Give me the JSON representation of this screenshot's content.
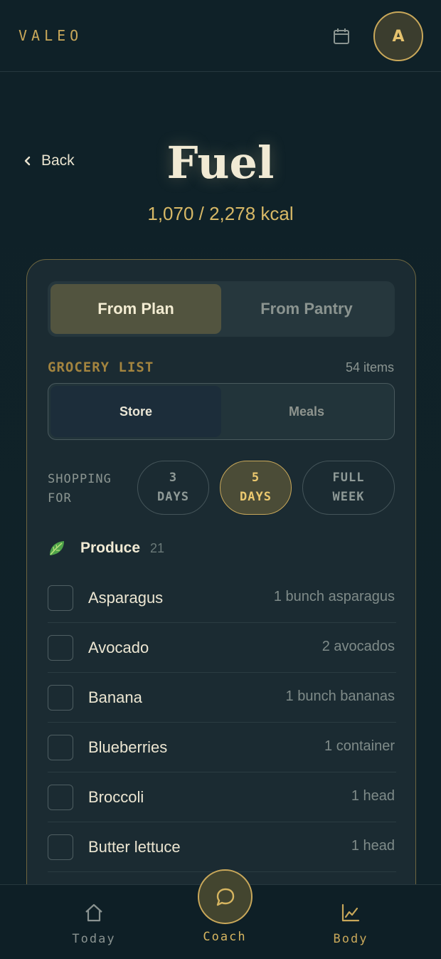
{
  "header": {
    "brand": "VALEO",
    "avatar_initial": "A"
  },
  "page": {
    "back_label": "Back",
    "title": "Fuel",
    "kcal": "1,070 / 2,278 kcal"
  },
  "source_toggle": {
    "options": [
      "From Plan",
      "From Pantry"
    ],
    "selected": "From Plan"
  },
  "grocery": {
    "label": "GROCERY LIST",
    "count": "54 items",
    "view_toggle": {
      "options": [
        "Store",
        "Meals"
      ],
      "selected": "Store"
    },
    "shopping_for_label": "SHOPPING FOR",
    "durations": [
      {
        "line1": "3",
        "line2": "DAYS"
      },
      {
        "line1": "5",
        "line2": "DAYS"
      },
      {
        "line1": "FULL",
        "line2": "WEEK"
      }
    ],
    "selected_duration": "5 DAYS",
    "category": {
      "icon": "leafy-greens-icon",
      "name": "Produce",
      "count": "21"
    },
    "items": [
      {
        "name": "Asparagus",
        "qty": "1 bunch asparagus",
        "checked": false
      },
      {
        "name": "Avocado",
        "qty": "2 avocados",
        "checked": false
      },
      {
        "name": "Banana",
        "qty": "1 bunch bananas",
        "checked": false
      },
      {
        "name": "Blueberries",
        "qty": "1 container",
        "checked": false
      },
      {
        "name": "Broccoli",
        "qty": "1 head",
        "checked": false
      },
      {
        "name": "Butter lettuce",
        "qty": "1 head",
        "checked": false
      }
    ]
  },
  "nav": {
    "today": "Today",
    "coach": "Coach",
    "body": "Body",
    "active": "Body"
  },
  "colors": {
    "accent_gold": "#c9a85a",
    "background": "#0f2128",
    "card": "#1b2b32"
  }
}
